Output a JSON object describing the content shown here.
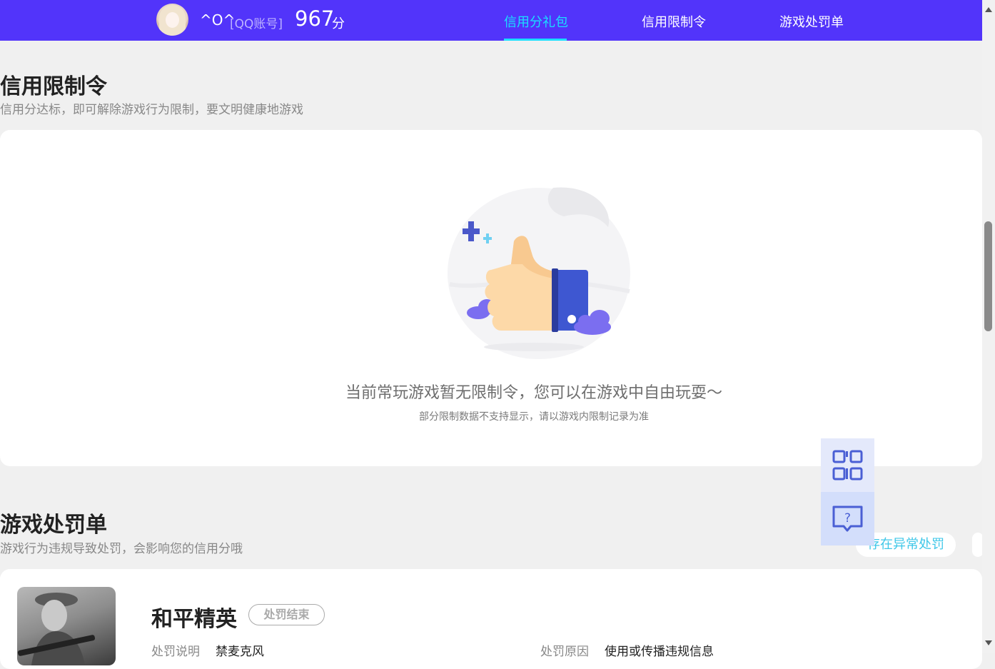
{
  "header": {
    "nickname": "^O^",
    "account_label": "[QQ账号]",
    "score": "967",
    "score_unit": "分",
    "tabs": [
      {
        "label": "信用分礼包",
        "active": true
      },
      {
        "label": "信用限制令",
        "active": false
      },
      {
        "label": "游戏处罚单",
        "active": false
      }
    ]
  },
  "restriction": {
    "title": "信用限制令",
    "subtitle": "信用分达标，即可解除游戏行为限制，要文明健康地游戏",
    "empty_title": "当前常玩游戏暂无限制令，您可以在游戏中自由玩耍～",
    "empty_note": "部分限制数据不支持显示，请以游戏内限制记录为准"
  },
  "penalty": {
    "title": "游戏处罚单",
    "subtitle": "游戏行为违规导致处罚，会影响您的信用分哦",
    "filter_label": "存在异常处罚",
    "item": {
      "game": "和平精英",
      "status": "处罚结束",
      "desc_label": "处罚说明",
      "desc_value": "禁麦克风",
      "reason_label": "处罚原因",
      "reason_value": "使用或传播违规信息"
    }
  },
  "colors": {
    "header_bg": "#5234fa",
    "active_tab": "#19e0ff",
    "accent_blue": "#4a5fd4"
  },
  "icons": {
    "qr": "qr-code-icon",
    "help": "question-chat-icon"
  }
}
